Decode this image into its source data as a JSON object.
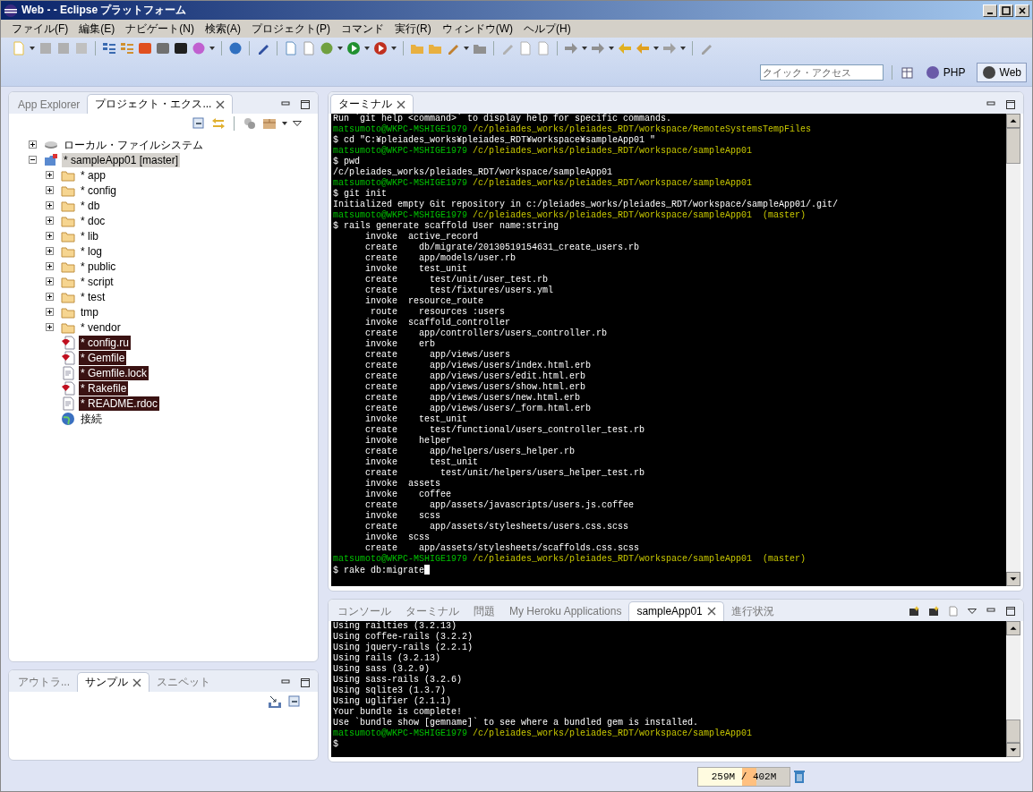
{
  "window": {
    "title": "Web -  - Eclipse プラットフォーム"
  },
  "menu": [
    "ファイル(F)",
    "編集(E)",
    "ナビゲート(N)",
    "検索(A)",
    "プロジェクト(P)",
    "コマンド",
    "実行(R)",
    "ウィンドウ(W)",
    "ヘルプ(H)"
  ],
  "quick_access": {
    "placeholder": "クイック・アクセス"
  },
  "perspectives": [
    {
      "label": "PHP",
      "selected": false
    },
    {
      "label": "Web",
      "selected": true
    }
  ],
  "project_panel": {
    "tabs": [
      {
        "label": "App Explorer",
        "selected": false
      },
      {
        "label": "プロジェクト・エクス...",
        "selected": true
      }
    ],
    "tree": [
      {
        "label": "ローカル・ファイルシステム",
        "kind": "drive",
        "expanded": false,
        "selected": false,
        "highlighted": false
      },
      {
        "label": "* sampleApp01 [master]",
        "kind": "project",
        "expanded": true,
        "selected": true,
        "highlighted": false,
        "children": [
          {
            "label": "* app",
            "kind": "folder",
            "expanded": false,
            "selected": false,
            "highlighted": false
          },
          {
            "label": "* config",
            "kind": "folder",
            "expanded": false,
            "selected": false,
            "highlighted": false
          },
          {
            "label": "* db",
            "kind": "folder",
            "expanded": false,
            "selected": false,
            "highlighted": false
          },
          {
            "label": "* doc",
            "kind": "folder",
            "expanded": false,
            "selected": false,
            "highlighted": false
          },
          {
            "label": "* lib",
            "kind": "folder",
            "expanded": false,
            "selected": false,
            "highlighted": false
          },
          {
            "label": "* log",
            "kind": "folder",
            "expanded": false,
            "selected": false,
            "highlighted": false
          },
          {
            "label": "* public",
            "kind": "folder",
            "expanded": false,
            "selected": false,
            "highlighted": false
          },
          {
            "label": "* script",
            "kind": "folder",
            "expanded": false,
            "selected": false,
            "highlighted": false
          },
          {
            "label": "* test",
            "kind": "folder",
            "expanded": false,
            "selected": false,
            "highlighted": false
          },
          {
            "label": "tmp",
            "kind": "folder",
            "expanded": false,
            "selected": false,
            "highlighted": false
          },
          {
            "label": "* vendor",
            "kind": "folder",
            "expanded": false,
            "selected": false,
            "highlighted": false
          },
          {
            "label": "* config.ru",
            "kind": "ruby",
            "selected": false,
            "highlighted": true
          },
          {
            "label": "* Gemfile",
            "kind": "ruby",
            "selected": false,
            "highlighted": true
          },
          {
            "label": "* Gemfile.lock",
            "kind": "file",
            "selected": false,
            "highlighted": true
          },
          {
            "label": "* Rakefile",
            "kind": "ruby",
            "selected": false,
            "highlighted": true
          },
          {
            "label": "* README.rdoc",
            "kind": "file",
            "selected": false,
            "highlighted": true
          },
          {
            "label": "接続",
            "kind": "connection",
            "selected": false,
            "highlighted": false
          }
        ]
      }
    ]
  },
  "outline_panel": {
    "tabs": [
      {
        "label": "アウトラ...",
        "selected": false
      },
      {
        "label": "サンプル",
        "selected": true
      },
      {
        "label": "スニペット",
        "selected": false
      }
    ]
  },
  "terminal": {
    "tab": {
      "label": "ターミナル",
      "selected": true
    },
    "cursor_visible": true,
    "lines": [
      {
        "kind": "output",
        "text": "Run `git help <command>` to display help for specific commands."
      },
      {
        "kind": "prompt",
        "user": "matsumoto@WKPC-MSHIGE1979",
        "path": "/c/pleiades_works/pleiades_RDT/workspace/RemoteSystemsTempFiles"
      },
      {
        "kind": "output",
        "text": "$ cd \"C:¥pleiades_works¥pleiades_RDT¥workspace¥sampleApp01 \""
      },
      {
        "kind": "prompt",
        "user": "matsumoto@WKPC-MSHIGE1979",
        "path": "/c/pleiades_works/pleiades_RDT/workspace/sampleApp01"
      },
      {
        "kind": "output",
        "text": "$ pwd"
      },
      {
        "kind": "output",
        "text": "/c/pleiades_works/pleiades_RDT/workspace/sampleApp01"
      },
      {
        "kind": "prompt",
        "user": "matsumoto@WKPC-MSHIGE1979",
        "path": "/c/pleiades_works/pleiades_RDT/workspace/sampleApp01"
      },
      {
        "kind": "output",
        "text": "$ git init"
      },
      {
        "kind": "output",
        "text": "Initialized empty Git repository in c:/pleiades_works/pleiades_RDT/workspace/sampleApp01/.git/"
      },
      {
        "kind": "prompt",
        "user": "matsumoto@WKPC-MSHIGE1979",
        "path": "/c/pleiades_works/pleiades_RDT/workspace/sampleApp01",
        "branch": "(master)"
      },
      {
        "kind": "output",
        "text": "$ rails generate scaffold User name:string"
      },
      {
        "kind": "output",
        "text": "      invoke  active_record"
      },
      {
        "kind": "output",
        "text": "      create    db/migrate/20130519154631_create_users.rb"
      },
      {
        "kind": "output",
        "text": "      create    app/models/user.rb"
      },
      {
        "kind": "output",
        "text": "      invoke    test_unit"
      },
      {
        "kind": "output",
        "text": "      create      test/unit/user_test.rb"
      },
      {
        "kind": "output",
        "text": "      create      test/fixtures/users.yml"
      },
      {
        "kind": "output",
        "text": "      invoke  resource_route"
      },
      {
        "kind": "output",
        "text": "       route    resources :users"
      },
      {
        "kind": "output",
        "text": "      invoke  scaffold_controller"
      },
      {
        "kind": "output",
        "text": "      create    app/controllers/users_controller.rb"
      },
      {
        "kind": "output",
        "text": "      invoke    erb"
      },
      {
        "kind": "output",
        "text": "      create      app/views/users"
      },
      {
        "kind": "output",
        "text": "      create      app/views/users/index.html.erb"
      },
      {
        "kind": "output",
        "text": "      create      app/views/users/edit.html.erb"
      },
      {
        "kind": "output",
        "text": "      create      app/views/users/show.html.erb"
      },
      {
        "kind": "output",
        "text": "      create      app/views/users/new.html.erb"
      },
      {
        "kind": "output",
        "text": "      create      app/views/users/_form.html.erb"
      },
      {
        "kind": "output",
        "text": "      invoke    test_unit"
      },
      {
        "kind": "output",
        "text": "      create      test/functional/users_controller_test.rb"
      },
      {
        "kind": "output",
        "text": "      invoke    helper"
      },
      {
        "kind": "output",
        "text": "      create      app/helpers/users_helper.rb"
      },
      {
        "kind": "output",
        "text": "      invoke      test_unit"
      },
      {
        "kind": "output",
        "text": "      create        test/unit/helpers/users_helper_test.rb"
      },
      {
        "kind": "output",
        "text": "      invoke  assets"
      },
      {
        "kind": "output",
        "text": "      invoke    coffee"
      },
      {
        "kind": "output",
        "text": "      create      app/assets/javascripts/users.js.coffee"
      },
      {
        "kind": "output",
        "text": "      invoke    scss"
      },
      {
        "kind": "output",
        "text": "      create      app/assets/stylesheets/users.css.scss"
      },
      {
        "kind": "output",
        "text": "      invoke  scss"
      },
      {
        "kind": "output",
        "text": "      create    app/assets/stylesheets/scaffolds.css.scss"
      },
      {
        "kind": "prompt",
        "user": "matsumoto@WKPC-MSHIGE1979",
        "path": "/c/pleiades_works/pleiades_RDT/workspace/sampleApp01",
        "branch": "(master)"
      },
      {
        "kind": "output",
        "text": "$ rake db:migrate"
      }
    ]
  },
  "console": {
    "tabs": [
      {
        "label": "コンソール",
        "selected": false
      },
      {
        "label": "ターミナル",
        "selected": false
      },
      {
        "label": "問題",
        "selected": false
      },
      {
        "label": "My Heroku Applications",
        "selected": false
      },
      {
        "label": "sampleApp01",
        "selected": true
      },
      {
        "label": "進行状況",
        "selected": false
      }
    ],
    "lines": [
      {
        "kind": "output",
        "text": "Using railties (3.2.13)"
      },
      {
        "kind": "output",
        "text": "Using coffee-rails (3.2.2)"
      },
      {
        "kind": "output",
        "text": "Using jquery-rails (2.2.1)"
      },
      {
        "kind": "output",
        "text": "Using rails (3.2.13)"
      },
      {
        "kind": "output",
        "text": "Using sass (3.2.9)"
      },
      {
        "kind": "output",
        "text": "Using sass-rails (3.2.6)"
      },
      {
        "kind": "output",
        "text": "Using sqlite3 (1.3.7)"
      },
      {
        "kind": "output",
        "text": "Using uglifier (2.1.1)"
      },
      {
        "kind": "output",
        "text": "Your bundle is complete!"
      },
      {
        "kind": "output",
        "text": "Use `bundle show [gemname]` to see where a bundled gem is installed."
      },
      {
        "kind": "prompt",
        "user": "matsumoto@WKPC-MSHIGE1979",
        "path": "/c/pleiades_works/pleiades_RDT/workspace/sampleApp01"
      },
      {
        "kind": "output",
        "text": "$"
      }
    ]
  },
  "heap_status": {
    "text": "259M / 402M",
    "level": 0.64
  }
}
